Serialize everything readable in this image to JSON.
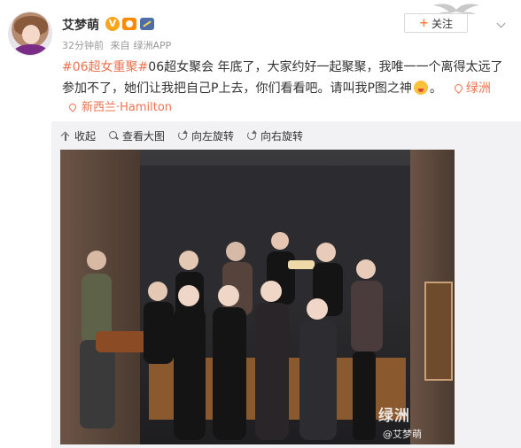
{
  "user": {
    "name": "艾梦萌",
    "vip_badge": "V",
    "time": "32分钟前",
    "source_prefix": "来自",
    "source": "绿洲APP"
  },
  "follow": {
    "plus": "+",
    "label": "关注"
  },
  "post": {
    "hashtag": "#06超女重聚#",
    "text": "06超女聚会 年底了，大家约好一起聚聚，我唯一一个离得太远了参加不了，她们让我把自己P上去，你们看看吧。请叫我P图之神",
    "text_end": "。",
    "source_link": "绿洲"
  },
  "location": "新西兰·Hamilton",
  "toolbar": {
    "collapse": "收起",
    "view_large": "查看大图",
    "rotate_left": "向左旋转",
    "rotate_right": "向右旋转"
  },
  "watermark": {
    "logo": "绿洲",
    "user": "@艾梦萌"
  },
  "icons": [
    "avatar",
    "vip-badge",
    "level-badge",
    "member-badge",
    "wing-decor",
    "more-icon",
    "pin-icon",
    "emoji",
    "collapse-icon",
    "zoom-icon",
    "rotate-left-icon",
    "rotate-right-icon"
  ],
  "colors": {
    "accent": "#eb7350",
    "muted": "#999999",
    "toolbar_bg": "#f2f2f5",
    "vip": "#f8a51c"
  }
}
